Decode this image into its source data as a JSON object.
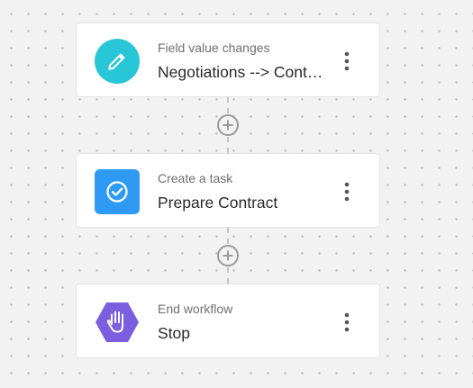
{
  "workflow": {
    "nodes": [
      {
        "subtitle": "Field value changes",
        "title": "Negotiations --> Contract",
        "icon": "pencil-icon",
        "icon_color": "#29c6d8"
      },
      {
        "subtitle": "Create a task",
        "title": "Prepare Contract",
        "icon": "check-circle-icon",
        "icon_color": "#2e9af4"
      },
      {
        "subtitle": "End workflow",
        "title": "Stop",
        "icon": "hand-stop-icon",
        "icon_color": "#7b5fe0"
      }
    ],
    "add_step_icon": "plus-circle-icon",
    "menu_icon": "more-vertical-icon"
  },
  "colors": {
    "canvas_background": "#f2f2f2",
    "grid_dot": "#b9b9b9",
    "connector": "#c4c4c4"
  }
}
